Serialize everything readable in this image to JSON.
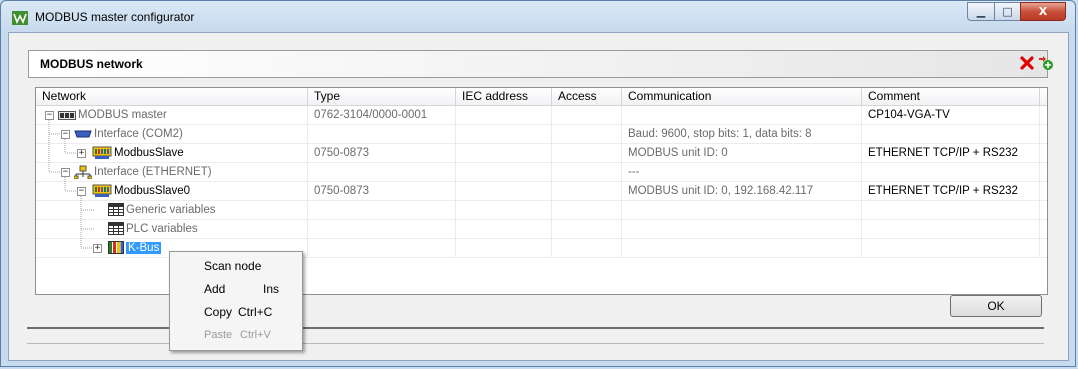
{
  "window": {
    "title": "MODBUS master configurator",
    "min_glyph": "▁",
    "max_glyph": "□",
    "close_glyph": "X"
  },
  "panel": {
    "title": "MODBUS network"
  },
  "columns": [
    "Network",
    "Type",
    "IEC address",
    "Access",
    "Communication",
    "Comment"
  ],
  "rows": [
    {
      "network": "MODBUS master",
      "type": "0762-3104/0000-0001",
      "iec": "",
      "access": "",
      "communication": "",
      "comment": "CP104-VGA-TV"
    },
    {
      "network": "Interface (COM2)",
      "type": "",
      "iec": "",
      "access": "",
      "communication": "Baud: 9600, stop bits: 1, data bits: 8",
      "comment": ""
    },
    {
      "network": "ModbusSlave",
      "type": "0750-0873",
      "iec": "",
      "access": "",
      "communication": "MODBUS unit ID: 0",
      "comment": "ETHERNET TCP/IP + RS232"
    },
    {
      "network": "Interface (ETHERNET)",
      "type": "",
      "iec": "",
      "access": "",
      "communication": "---",
      "comment": ""
    },
    {
      "network": "ModbusSlave0",
      "type": "0750-0873",
      "iec": "",
      "access": "",
      "communication": "MODBUS unit ID: 0, 192.168.42.117",
      "comment": "ETHERNET TCP/IP + RS232"
    },
    {
      "network": "Generic variables",
      "type": "",
      "iec": "",
      "access": "",
      "communication": "",
      "comment": ""
    },
    {
      "network": "PLC variables",
      "type": "",
      "iec": "",
      "access": "",
      "communication": "",
      "comment": ""
    },
    {
      "network": "K-Bus",
      "type": "",
      "iec": "",
      "access": "",
      "communication": "",
      "comment": ""
    }
  ],
  "context_menu": {
    "items": [
      {
        "label": "Scan node",
        "shortcut": ""
      },
      {
        "label": "Add",
        "shortcut": "Ins"
      },
      {
        "label": "Copy",
        "shortcut": "Ctrl+C"
      },
      {
        "label": "Paste",
        "shortcut": "Ctrl+V"
      }
    ]
  },
  "buttons": {
    "ok": "OK"
  },
  "colors": {
    "selection": "#3399ff",
    "delete_icon": "#e00000",
    "add_icon": "#2a9a2a"
  }
}
